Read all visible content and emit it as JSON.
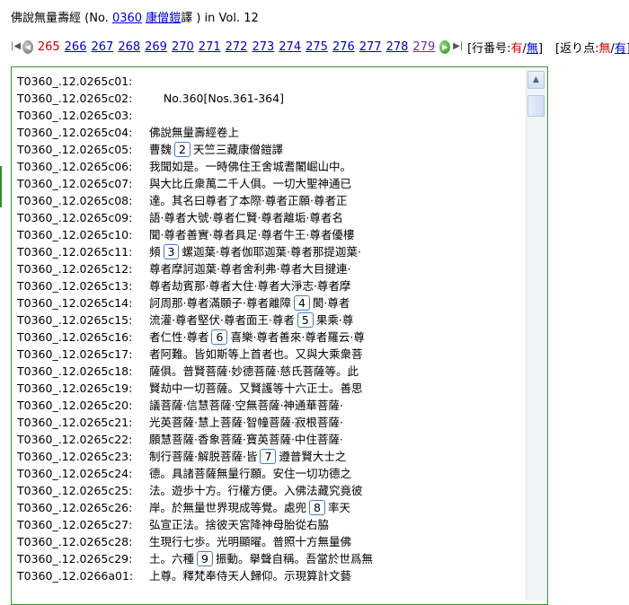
{
  "header": {
    "title_text": "佛說無量壽經",
    "no_open": " (No. ",
    "text_no": "0360",
    "translator": "康僧鎧",
    "translator_suffix": "譯 ) in Vol. ",
    "vol": "12"
  },
  "nav": {
    "first_icon": "first-page-icon",
    "prev_icon": "prev-page-icon",
    "next_icon": "next-page-icon",
    "last_icon": "last-page-icon",
    "current_page": "265",
    "pages": [
      "266",
      "267",
      "268",
      "269",
      "270",
      "271",
      "272",
      "273",
      "274",
      "275",
      "276",
      "277",
      "278",
      "279"
    ],
    "line_no_label": "[行番号:",
    "line_no_on": "有",
    "sep1": "/",
    "line_no_off": "無",
    "line_no_close": "]",
    "kaeri_label": "[返り点:",
    "kaeri_off": "無",
    "sep2": "/",
    "kaeri_on": "有",
    "kaeri_close": "]"
  },
  "lines": [
    {
      "id": "T0360_.12.0265c01:",
      "parts": [
        {
          "t": ""
        }
      ]
    },
    {
      "id": "T0360_.12.0265c02:",
      "parts": [
        {
          "t": "    No.360[Nos.361-364]"
        }
      ]
    },
    {
      "id": "T0360_.12.0265c03:",
      "parts": [
        {
          "t": ""
        }
      ]
    },
    {
      "id": "T0360_.12.0265c04:",
      "parts": [
        {
          "t": "佛說無量壽經卷上"
        }
      ]
    },
    {
      "id": "T0360_.12.0265c05:",
      "parts": [
        {
          "t": "曹魏"
        },
        {
          "n": "2"
        },
        {
          "t": "天竺三藏康僧鎧譯"
        }
      ]
    },
    {
      "id": "T0360_.12.0265c06:",
      "parts": [
        {
          "t": "我聞如是。一時佛住王舍城耆闍崛山中。"
        }
      ]
    },
    {
      "id": "T0360_.12.0265c07:",
      "parts": [
        {
          "t": "與大比丘衆萬二千人俱。一切大聖神通已"
        }
      ]
    },
    {
      "id": "T0360_.12.0265c08:",
      "parts": [
        {
          "t": "達。其名曰尊者了本際·尊者正願·尊者正"
        }
      ]
    },
    {
      "id": "T0360_.12.0265c09:",
      "parts": [
        {
          "t": "語·尊者大號·尊者仁賢·尊者離垢·尊者名"
        }
      ]
    },
    {
      "id": "T0360_.12.0265c10:",
      "parts": [
        {
          "t": "聞·尊者善實·尊者具足·尊者牛王·尊者優樓"
        }
      ]
    },
    {
      "id": "T0360_.12.0265c11:",
      "parts": [
        {
          "t": "頻"
        },
        {
          "n": "3"
        },
        {
          "t": "螺迦葉·尊者伽耶迦葉·尊者那提迦葉·"
        }
      ]
    },
    {
      "id": "T0360_.12.0265c12:",
      "parts": [
        {
          "t": "尊者摩訶迦葉·尊者舍利弗·尊者大目揵連·"
        }
      ]
    },
    {
      "id": "T0360_.12.0265c13:",
      "parts": [
        {
          "t": "尊者劫賓那·尊者大住·尊者大淨志·尊者摩"
        }
      ]
    },
    {
      "id": "T0360_.12.0265c14:",
      "parts": [
        {
          "t": "訶周那·尊者滿願子·尊者離障"
        },
        {
          "n": "4"
        },
        {
          "t": "閡·尊者"
        }
      ]
    },
    {
      "id": "T0360_.12.0265c15:",
      "parts": [
        {
          "t": "流灌·尊者堅伏·尊者面王·尊者"
        },
        {
          "n": "5"
        },
        {
          "t": "果乘·尊"
        }
      ]
    },
    {
      "id": "T0360_.12.0265c16:",
      "parts": [
        {
          "t": "者仁性·尊者"
        },
        {
          "n": "6"
        },
        {
          "t": "喜樂·尊者善來·尊者羅云·尊"
        }
      ]
    },
    {
      "id": "T0360_.12.0265c17:",
      "parts": [
        {
          "t": "者阿難。皆如斯等上首者也。又與大乘衆菩"
        }
      ]
    },
    {
      "id": "T0360_.12.0265c18:",
      "parts": [
        {
          "t": "薩俱。普賢菩薩·妙德菩薩·慈氏菩薩等。此"
        }
      ]
    },
    {
      "id": "T0360_.12.0265c19:",
      "parts": [
        {
          "t": "賢劫中一切菩薩。又賢護等十六正士。善思"
        }
      ]
    },
    {
      "id": "T0360_.12.0265c20:",
      "parts": [
        {
          "t": "議菩薩·信慧菩薩·空無菩薩·神通華菩薩·"
        }
      ]
    },
    {
      "id": "T0360_.12.0265c21:",
      "parts": [
        {
          "t": "光英菩薩·慧上菩薩·智幢菩薩·寂根菩薩·"
        }
      ]
    },
    {
      "id": "T0360_.12.0265c22:",
      "parts": [
        {
          "t": "願慧菩薩·香象菩薩·寶英菩薩·中住菩薩·"
        }
      ]
    },
    {
      "id": "T0360_.12.0265c23:",
      "parts": [
        {
          "t": "制行菩薩·解脱菩薩·皆"
        },
        {
          "n": "7"
        },
        {
          "t": "遵普賢大士之"
        }
      ]
    },
    {
      "id": "T0360_.12.0265c24:",
      "parts": [
        {
          "t": "德。具諸菩薩無量行願。安住一切功德之"
        }
      ]
    },
    {
      "id": "T0360_.12.0265c25:",
      "parts": [
        {
          "t": "法。遊歩十方。行權方便。入佛法藏究竟彼"
        }
      ]
    },
    {
      "id": "T0360_.12.0265c26:",
      "parts": [
        {
          "t": "岸。於無量世界現成等覺。處兜"
        },
        {
          "n": "8"
        },
        {
          "t": "率天"
        }
      ]
    },
    {
      "id": "T0360_.12.0265c27:",
      "parts": [
        {
          "t": "弘宣正法。捨彼天宮降神母胎從右脇"
        }
      ]
    },
    {
      "id": "T0360_.12.0265c28:",
      "parts": [
        {
          "t": "生現行七歩。光明顯曜。普照十方無量佛"
        }
      ]
    },
    {
      "id": "T0360_.12.0265c29:",
      "parts": [
        {
          "t": "土。六種"
        },
        {
          "n": "9"
        },
        {
          "t": "振動。擧聲自稱。吾當於世爲無"
        }
      ]
    },
    {
      "id": "T0360_.12.0266a01:",
      "parts": [
        {
          "t": "上尊。釋梵奉侍天人歸仰。示現算計文藝"
        }
      ]
    }
  ],
  "scrollbar": {
    "up_icon": "scroll-up-arrow-icon"
  }
}
